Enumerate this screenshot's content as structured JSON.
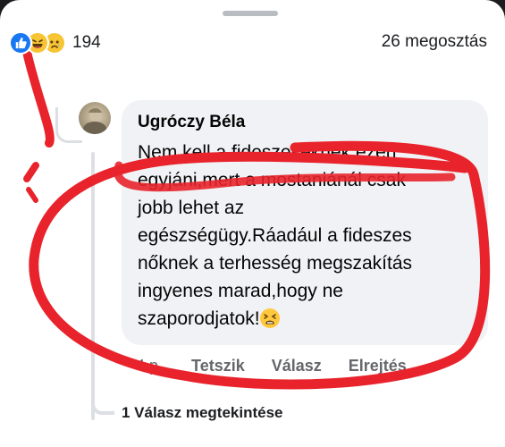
{
  "post_stats": {
    "reactions": [
      "like-icon",
      "haha-icon",
      "sad-icon"
    ],
    "reaction_count": "194",
    "share_count": "26 megosztás"
  },
  "comment": {
    "author": "Ugróczy Béla",
    "text": "Nem kell a fideszeseknek ezen\negyjáni,mert a mostaniánál csak\njobb lehet az\negészségügy.Ráadául a fideszes\nnőknek a terhesség megszakítás\ningyenes marad,hogy ne\nszaporodjatok!",
    "emoji": "tired-face-emoji",
    "timestamp": "4 p.",
    "like_label": "Tetszik",
    "reply_label": "Válasz",
    "hide_label": "Elrejtés"
  },
  "replies": {
    "label": "1 Válasz megtekintése"
  },
  "colors": {
    "annotation_red": "#e8232b",
    "like_blue": "#1877f2",
    "bubble_bg": "#f0f2f5"
  }
}
